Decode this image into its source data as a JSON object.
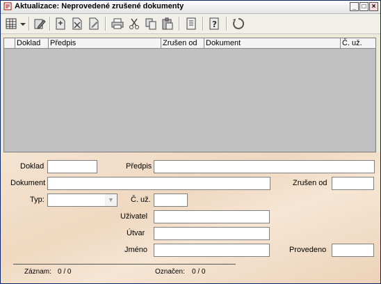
{
  "window": {
    "title": "Aktualizace: Neprovedené zrušené dokumenty",
    "buttons": {
      "minimize": "_",
      "maximize": "□",
      "close": "×"
    }
  },
  "toolbar": {
    "icons": [
      "table-icon",
      "dropdown-arrow-icon",
      "edit-icon",
      "add-document-icon",
      "delete-icon",
      "edit-document-icon",
      "print-icon",
      "cut-icon",
      "copy-icon",
      "paste-icon",
      "notes-icon",
      "help-icon",
      "recycle-icon"
    ]
  },
  "grid": {
    "columns": [
      "Doklad",
      "Předpis",
      "Zrušen od",
      "Dokument",
      "Č. už."
    ]
  },
  "form": {
    "doklad_label": "Doklad",
    "predpis_label": "Předpis",
    "dokument_label": "Dokument",
    "zrusen_od_label": "Zrušen od",
    "typ_label": "Typ:",
    "c_uz_label": "Č. už.",
    "uzivatel_label": "Uživatel",
    "utvar_label": "Útvar",
    "jmeno_label": "Jméno",
    "provedeno_label": "Provedeno",
    "doklad_value": "",
    "predpis_value": "",
    "dokument_value": "",
    "zrusen_od_value": "",
    "typ_value": "",
    "c_uz_value": "",
    "uzivatel_value": "",
    "utvar_value": "",
    "jmeno_value": "",
    "provedeno_value": ""
  },
  "status": {
    "zaznam_label": "Záznam:",
    "zaznam_value": "0 / 0",
    "oznacen_label": "Označen:",
    "oznacen_value": "0 / 0"
  }
}
